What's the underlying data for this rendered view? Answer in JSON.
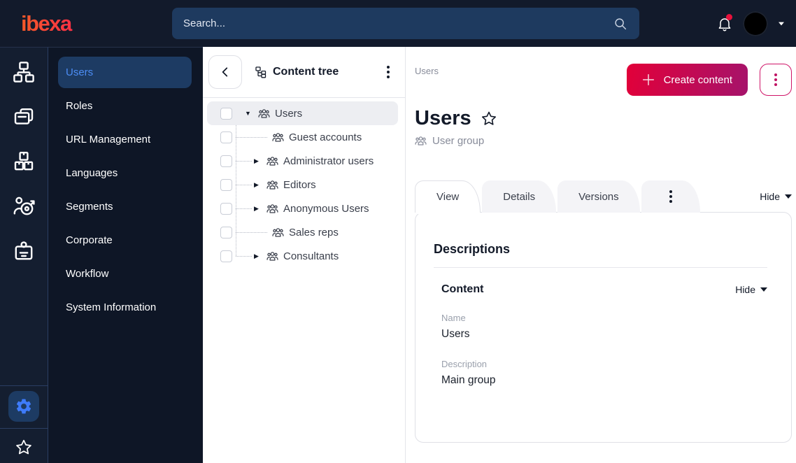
{
  "topbar": {
    "logo": "ibexa",
    "search_placeholder": "Search...",
    "notification_dot": true
  },
  "rail": {
    "items": [
      {
        "icon": "sitemap-icon"
      },
      {
        "icon": "pages-icon"
      },
      {
        "icon": "products-icon"
      },
      {
        "icon": "audience-icon"
      },
      {
        "icon": "badge-icon"
      }
    ],
    "bottom": [
      {
        "icon": "settings-gear-icon",
        "active": true
      },
      {
        "icon": "bookmark-star-icon"
      }
    ]
  },
  "sidebar": {
    "items": [
      {
        "label": "Users",
        "active": true
      },
      {
        "label": "Roles"
      },
      {
        "label": "URL Management"
      },
      {
        "label": "Languages"
      },
      {
        "label": "Segments"
      },
      {
        "label": "Corporate"
      },
      {
        "label": "Workflow"
      },
      {
        "label": "System Information"
      }
    ]
  },
  "content_tree": {
    "title": "Content tree",
    "items": [
      {
        "label": "Users",
        "level": 0,
        "expander": "expanded",
        "selected": true
      },
      {
        "label": "Guest accounts",
        "level": 1,
        "expander": "none"
      },
      {
        "label": "Administrator users",
        "level": 1,
        "expander": "collapsed"
      },
      {
        "label": "Editors",
        "level": 1,
        "expander": "collapsed"
      },
      {
        "label": "Anonymous Users",
        "level": 1,
        "expander": "collapsed"
      },
      {
        "label": "Sales reps",
        "level": 1,
        "expander": "none"
      },
      {
        "label": "Consultants",
        "level": 1,
        "expander": "collapsed"
      }
    ]
  },
  "main": {
    "breadcrumb": "Users",
    "create_button": "Create content",
    "title": "Users",
    "content_type": "User group",
    "tabs": [
      {
        "label": "View",
        "active": true
      },
      {
        "label": "Details"
      },
      {
        "label": "Versions"
      },
      {
        "type": "kebab"
      }
    ],
    "hide_label": "Hide",
    "card": {
      "section_title": "Descriptions",
      "group_title": "Content",
      "group_hide_label": "Hide",
      "fields": [
        {
          "label": "Name",
          "value": "Users"
        },
        {
          "label": "Description",
          "value": "Main group"
        }
      ]
    }
  },
  "colors": {
    "dark_top": "#121a2b",
    "search_bg": "#1e3a5f",
    "active_pill": "#1d3b63",
    "active_blue": "#4c8df5",
    "accent_start": "#e20039",
    "accent_end": "#a5136b"
  }
}
